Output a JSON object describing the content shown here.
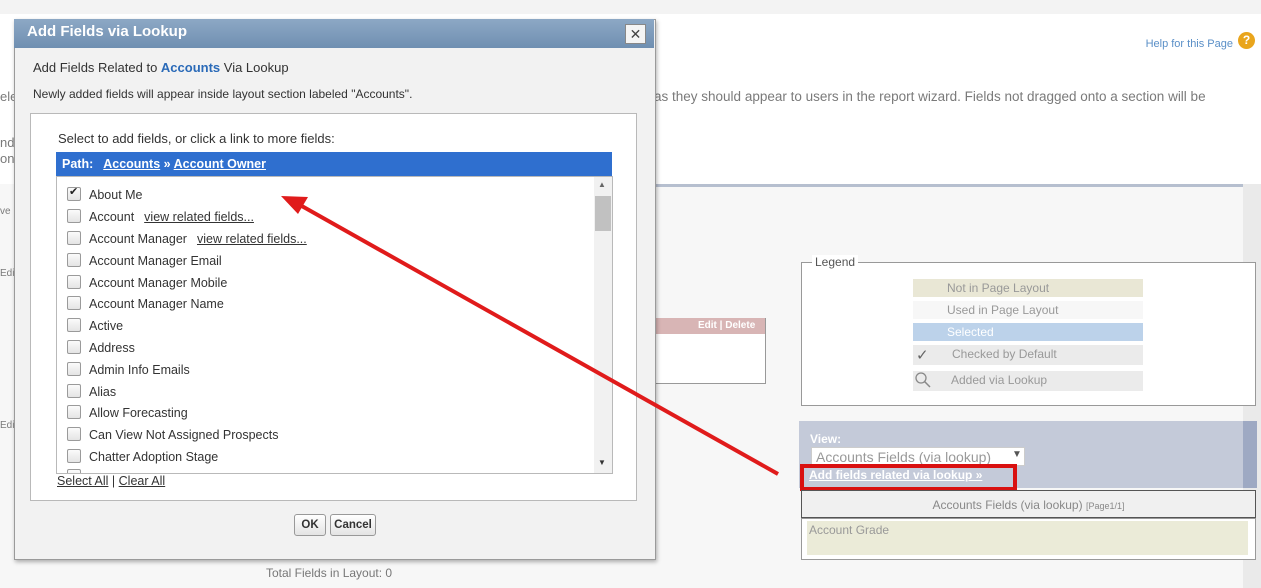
{
  "page": {
    "help_link": "Help for this Page",
    "help_icon": "question-icon",
    "instruction_fragment": "ns as they should appear to users in the report wizard. Fields not dragged onto a section will be",
    "left_fragments": [
      "ele",
      "nd",
      "on",
      "ve",
      "Edi",
      "Edi"
    ],
    "section_actions": "Edit | Delete",
    "total_fields": "Total Fields in Layout: 0"
  },
  "legend": {
    "title": "Legend",
    "items": [
      {
        "label": "Not in Page Layout",
        "color": "#e9e7d5"
      },
      {
        "label": "Used in Page Layout",
        "color": "#f7f7f7"
      },
      {
        "label": "Selected",
        "color": "#bcd2ea"
      },
      {
        "label": "Checked by Default",
        "color": "#ebebeb",
        "icon": "checkmark-icon"
      },
      {
        "label": "Added via Lookup",
        "color": "#ebebeb",
        "icon": "search-icon"
      }
    ]
  },
  "view": {
    "label": "View:",
    "selected": "Accounts Fields (via lookup)",
    "add_link": "Add fields related via lookup »",
    "section_header": "Accounts Fields (via lookup)",
    "section_page": "[Page1/1]",
    "field": "Account Grade"
  },
  "dialog": {
    "title": "Add Fields via Lookup",
    "close_icon": "close-icon",
    "heading_pre": "Add Fields Related to ",
    "heading_obj": "Accounts",
    "heading_post": " Via Lookup",
    "note": "Newly added fields will appear inside layout section labeled \"Accounts\".",
    "prompt": "Select to add fields, or click a link to more fields:",
    "path_label": "Path:",
    "path_links": [
      "Accounts",
      "Account Owner"
    ],
    "path_separator": "»",
    "fields": [
      {
        "label": "About Me",
        "checked": true,
        "link": ""
      },
      {
        "label": "Account",
        "checked": false,
        "link": "view related fields..."
      },
      {
        "label": "Account Manager",
        "checked": false,
        "link": "view related fields..."
      },
      {
        "label": "Account Manager Email",
        "checked": false,
        "link": ""
      },
      {
        "label": "Account Manager Mobile",
        "checked": false,
        "link": ""
      },
      {
        "label": "Account Manager Name",
        "checked": false,
        "link": ""
      },
      {
        "label": "Active",
        "checked": false,
        "link": ""
      },
      {
        "label": "Address",
        "checked": false,
        "link": ""
      },
      {
        "label": "Admin Info Emails",
        "checked": false,
        "link": ""
      },
      {
        "label": "Alias",
        "checked": false,
        "link": ""
      },
      {
        "label": "Allow Forecasting",
        "checked": false,
        "link": ""
      },
      {
        "label": "Can View Not Assigned Prospects",
        "checked": false,
        "link": ""
      },
      {
        "label": "Chatter Adoption Stage",
        "checked": false,
        "link": ""
      }
    ],
    "select_all": "Select All",
    "clear_all": "Clear All",
    "link_separator": "|",
    "ok_label": "OK",
    "cancel_label": "Cancel"
  },
  "annotation": {
    "arrow_color": "#e01b1b"
  }
}
